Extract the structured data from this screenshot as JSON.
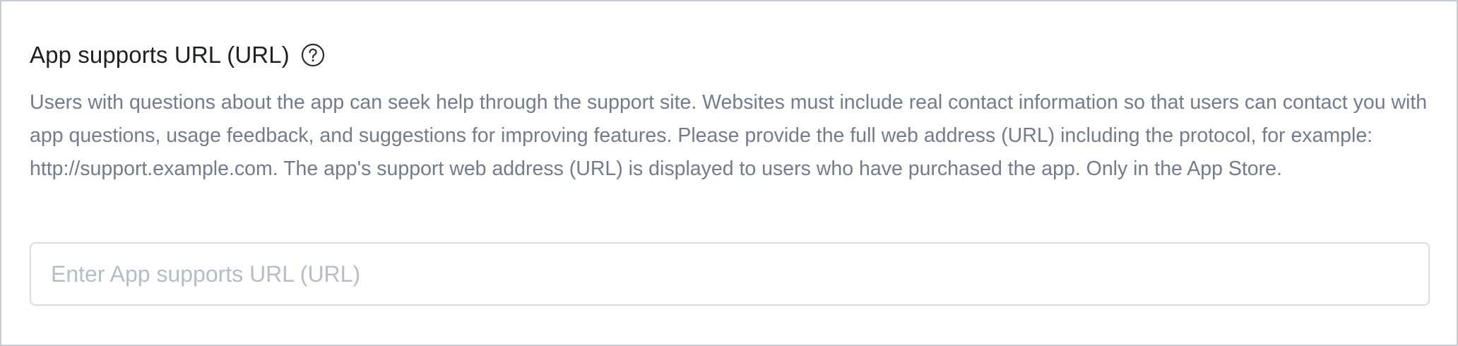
{
  "section": {
    "title": "App supports URL (URL)",
    "help_icon": "question-circle-icon",
    "description": "Users with questions about the app can seek help through the support site. Websites must include real contact information so that users can contact you with app questions, usage feedback, and suggestions for improving features. Please provide the full web address (URL) including the protocol, for example: http://support.example.com. The app's support web address (URL) is displayed to users who have purchased the app. Only in the App Store."
  },
  "input": {
    "value": "",
    "placeholder": "Enter App supports URL (URL)"
  },
  "colors": {
    "title": "#1f2023",
    "description": "#737b8c",
    "placeholder": "#b6bcc8",
    "input_border": "#d9dce2",
    "panel_border": "#c9ccd2"
  }
}
